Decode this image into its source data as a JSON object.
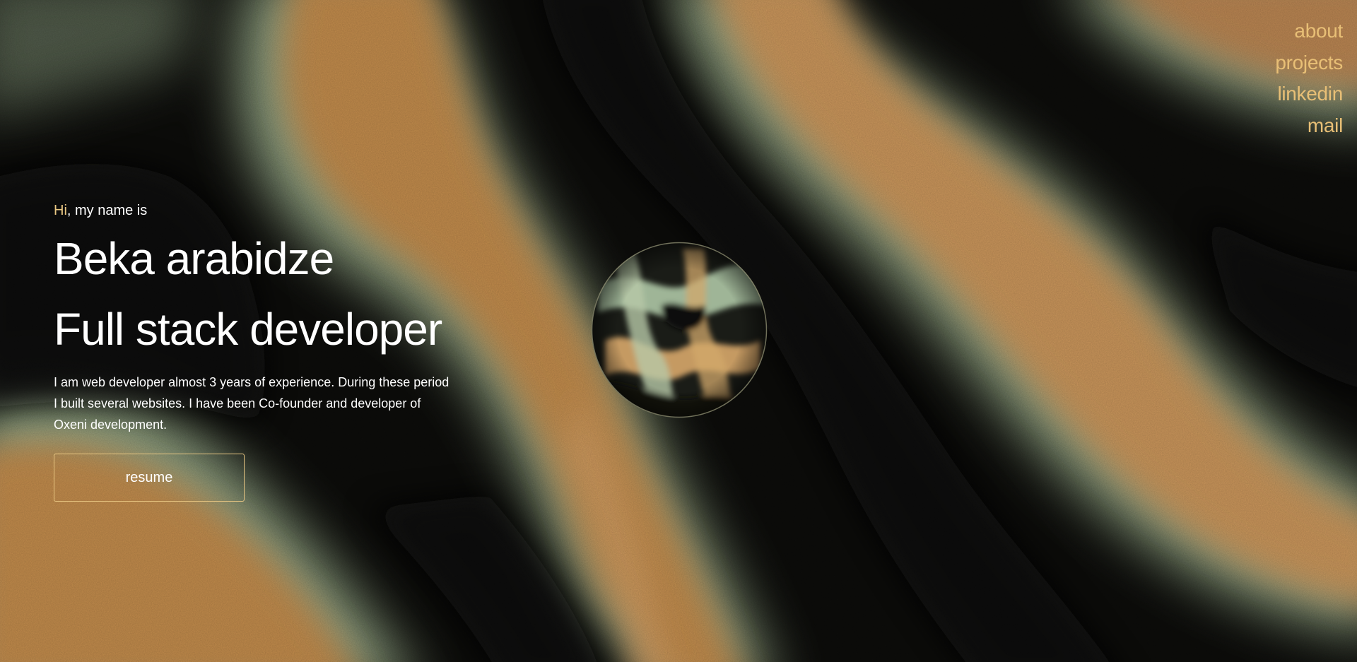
{
  "theme": {
    "accent": "#e9c783",
    "nav_color": "#e8bf76",
    "text": "#ffffff",
    "background_dark": "#0c0c0a",
    "wave_amber": "#c08a4c",
    "wave_sage": "#a9bf9a"
  },
  "nav": {
    "items": [
      {
        "label": "about"
      },
      {
        "label": "projects"
      },
      {
        "label": "linkedin"
      },
      {
        "label": "mail"
      }
    ]
  },
  "hero": {
    "greeting_highlight": "Hi",
    "greeting_rest": ", my name is",
    "name": "Beka arabidze",
    "role": "Full stack developer",
    "bio_lines": [
      "I am web developer almost 3 years of experience. During these period",
      "I built several websites. I have been Co-founder and developer of",
      "Oxeni development."
    ],
    "resume_label": "resume"
  },
  "orb": {
    "icon": "glass-sphere"
  }
}
